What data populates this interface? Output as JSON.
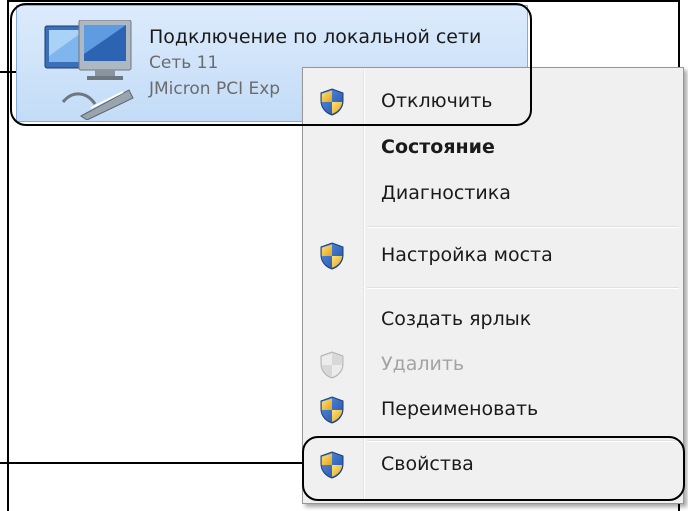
{
  "adapter": {
    "name": "Подключение по локальной сети",
    "network": "Сеть  11",
    "device": "JMicron PCI Exp",
    "icon": "network-adapter-icon"
  },
  "context_menu": {
    "items": [
      {
        "label": "Отключить",
        "icon": "uac-shield-icon",
        "bold": false,
        "disabled": false
      },
      {
        "label": "Состояние",
        "icon": null,
        "bold": true,
        "disabled": false
      },
      {
        "label": "Диагностика",
        "icon": null,
        "bold": false,
        "disabled": false
      },
      {
        "label": "Настройка моста",
        "icon": "uac-shield-icon",
        "bold": false,
        "disabled": false
      },
      {
        "label": "Создать ярлык",
        "icon": null,
        "bold": false,
        "disabled": false
      },
      {
        "label": "Удалить",
        "icon": "uac-shield-icon",
        "bold": false,
        "disabled": true
      },
      {
        "label": "Переименовать",
        "icon": "uac-shield-icon",
        "bold": false,
        "disabled": false
      },
      {
        "label": "Свойства",
        "icon": "uac-shield-icon",
        "bold": false,
        "disabled": false
      }
    ]
  },
  "colors": {
    "selection_background": "#c3dcf7",
    "menu_background": "#f0f0f0",
    "callout_border": "#000000"
  }
}
